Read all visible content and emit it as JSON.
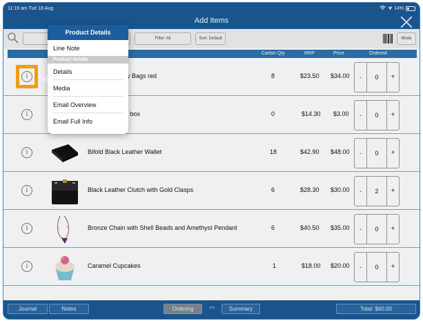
{
  "status_bar": {
    "time": "11:19 am  Tue 18 Aug",
    "battery": "14%"
  },
  "header": {
    "title": "Add Items"
  },
  "toolbar": {
    "filter_label": "Filter: All",
    "sort_label": "Sort: Default",
    "mode_label": "Mode"
  },
  "columns": {
    "carton_qty": "Carton Qty",
    "rrp": "RRP",
    "price": "Price",
    "ordered": "Ordered"
  },
  "products": [
    {
      "name": "Black Candy Bags red",
      "visible_name": "ndy Bags red",
      "carton_qty": "8",
      "rrp": "$23.50",
      "price": "$34.00",
      "ordered": "0",
      "thumb": "none"
    },
    {
      "name": "Truffle box",
      "visible_name": "ffle box",
      "carton_qty": "0",
      "rrp": "$14.30",
      "price": "$3.00",
      "ordered": "0",
      "thumb": "none"
    },
    {
      "name": "Bifold Black Leather Wallet",
      "visible_name": "Bifold Black Leather Wallet",
      "carton_qty": "18",
      "rrp": "$42.90",
      "price": "$48.00",
      "ordered": "0",
      "thumb": "wallet-icon"
    },
    {
      "name": "Black Leather Clutch with Gold Clasps",
      "visible_name": "Black Leather Clutch with Gold Clasps",
      "carton_qty": "6",
      "rrp": "$28.30",
      "price": "$30.00",
      "ordered": "2",
      "thumb": "clutch-icon"
    },
    {
      "name": "Bronze Chain with Shell Beads and Amethyst Pendant",
      "visible_name": "Bronze Chain with Shell Beads and Amethyst Pendant",
      "carton_qty": "6",
      "rrp": "$40.50",
      "price": "$35.00",
      "ordered": "0",
      "thumb": "necklace-icon"
    },
    {
      "name": "Caramel Cupcakes",
      "visible_name": "Caramel Cupcakes",
      "carton_qty": "1",
      "rrp": "$18.00",
      "price": "$20.00",
      "ordered": "0",
      "thumb": "cupcake-icon"
    }
  ],
  "popover": {
    "title": "Product Details",
    "line_note": "Line Note",
    "section_label": "Product details",
    "items": [
      "Details",
      "Media",
      "Email Overview",
      "Email Full Info"
    ]
  },
  "bottom_bar": {
    "journal": "Journal",
    "notes": "Notes",
    "ordering": "Ordering",
    "separator": ">>",
    "summary": "Summary",
    "total": "Total: $60.00"
  },
  "colors": {
    "brand_blue": "#1b5a96",
    "header_blue": "#2b73b3",
    "highlight_orange": "#f39c12"
  }
}
